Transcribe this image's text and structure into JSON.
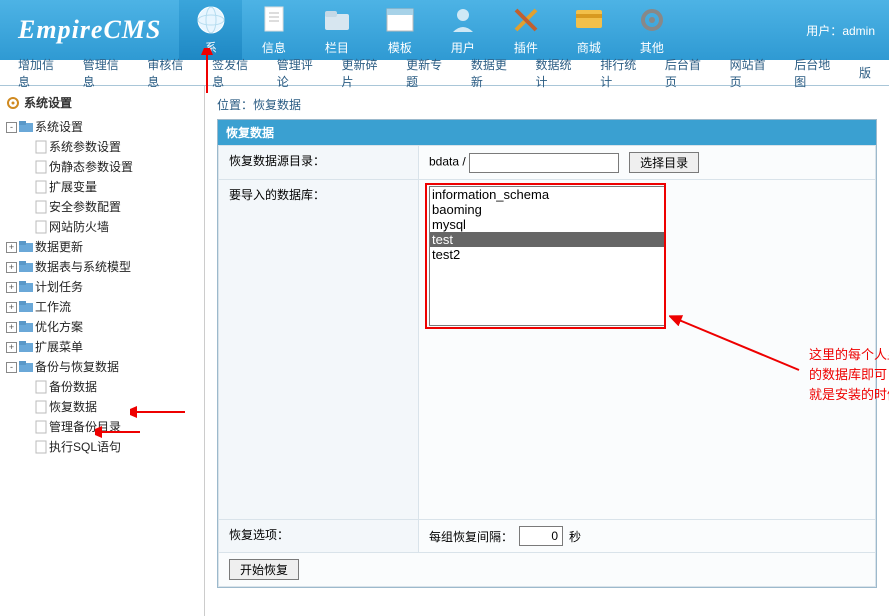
{
  "logo": "EmpireCMS",
  "user_label": "用户：",
  "user_name": "admin",
  "topnav": [
    {
      "label": "系"
    },
    {
      "label": "信息"
    },
    {
      "label": "栏目"
    },
    {
      "label": "模板"
    },
    {
      "label": "用户"
    },
    {
      "label": "插件"
    },
    {
      "label": "商城"
    },
    {
      "label": "其他"
    }
  ],
  "subnav": [
    "增加信息",
    "管理信息",
    "审核信息",
    "签发信息",
    "管理评论",
    "更新碎片",
    "更新专题",
    "数据更新",
    "数据统计",
    "排行统计",
    "后台首页",
    "网站首页",
    "后台地图",
    "版"
  ],
  "sidebar": {
    "title": "系统设置",
    "nodes": {
      "n0": "系统设置",
      "n0c": [
        "系统参数设置",
        "伪静态参数设置",
        "扩展变量",
        "安全参数配置",
        "网站防火墙"
      ],
      "list": [
        "数据更新",
        "数据表与系统模型",
        "计划任务",
        "工作流",
        "优化方案",
        "扩展菜单"
      ],
      "backup": "备份与恢复数据",
      "backup_c": [
        "备份数据",
        "恢复数据",
        "管理备份目录",
        "执行SQL语句"
      ]
    }
  },
  "breadcrumb_prefix": "位置：",
  "breadcrumb_page": "恢复数据",
  "panel_title": "恢复数据",
  "form": {
    "src_label": "恢复数据源目录：",
    "src_prefix": "bdata /",
    "src_value": "",
    "choose_btn": "选择目录",
    "db_label": "要导入的数据库：",
    "db_options": [
      "information_schema",
      "baoming",
      "mysql",
      "test",
      "test2"
    ],
    "db_selected": "test",
    "opts_label": "恢复选项：",
    "interval_label": "每组恢复间隔：",
    "interval_value": "0",
    "interval_unit": "秒",
    "submit": "开始恢复"
  },
  "annotation": {
    "line1": "这里的每个人显示的都不一样，选好你",
    "line2": "的数据库即可！test是我的数据库！也",
    "line3": "就是安装的时候的数据库！"
  }
}
